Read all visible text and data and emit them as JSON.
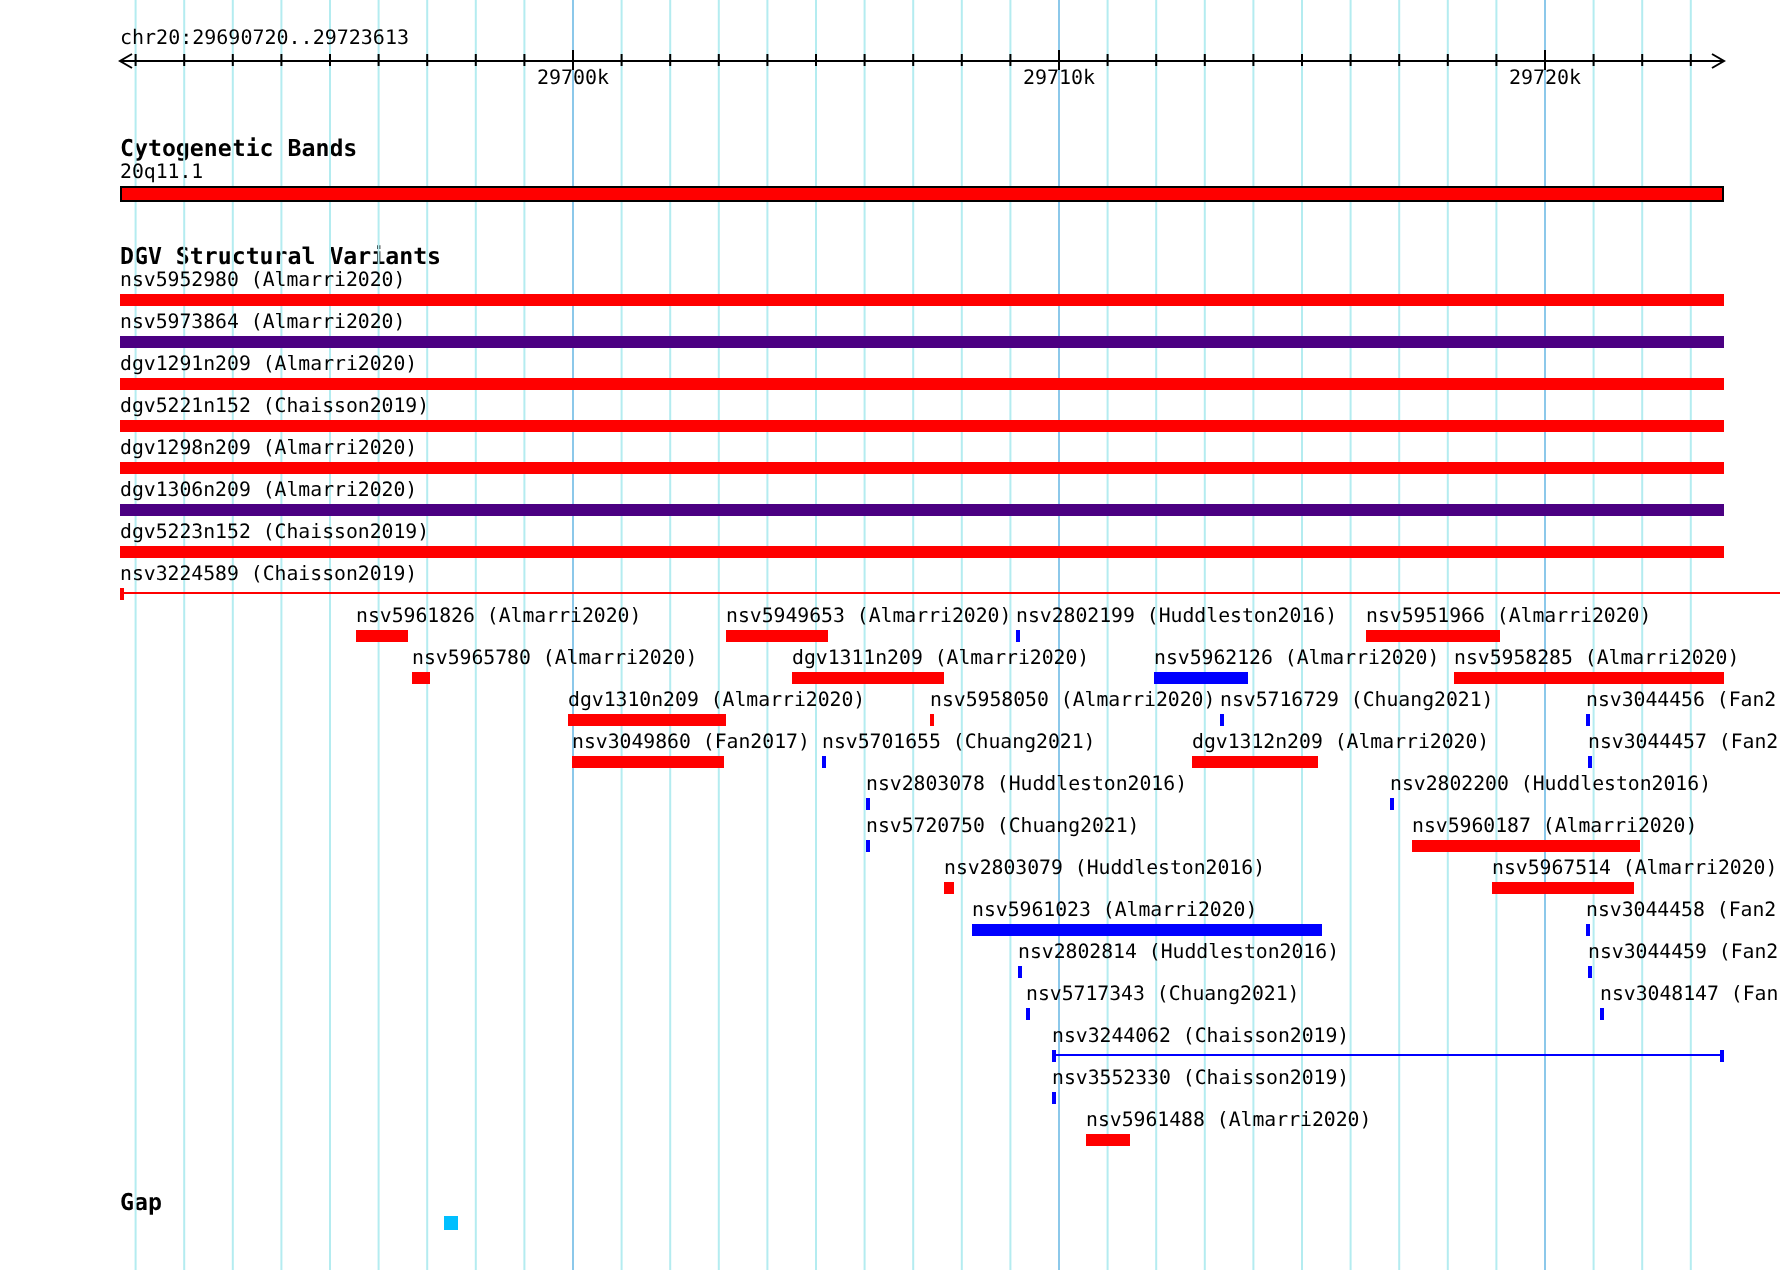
{
  "ruler": {
    "location": "chr20:29690720..29723613",
    "ticks": [
      "29700k",
      "29710k",
      "29720k"
    ]
  },
  "tracks": [
    {
      "kind": "cytoband",
      "title": "Cytogenetic Bands",
      "features": [
        {
          "label": "20q11.1",
          "color": "#ff0000"
        }
      ]
    },
    {
      "kind": "variants",
      "title": "DGV Structural Variants",
      "features": [
        {
          "label": "nsv5952980 (Almarri2020)",
          "color": "#ff0000",
          "kind": "bar"
        },
        {
          "label": "nsv5973864 (Almarri2020)",
          "color": "#4b0082",
          "kind": "bar"
        },
        {
          "label": "dgv1291n209 (Almarri2020)",
          "color": "#ff0000",
          "kind": "bar"
        },
        {
          "label": "dgv5221n152 (Chaisson2019)",
          "color": "#ff0000",
          "kind": "bar"
        },
        {
          "label": "dgv1298n209 (Almarri2020)",
          "color": "#ff0000",
          "kind": "bar"
        },
        {
          "label": "dgv1306n209 (Almarri2020)",
          "color": "#4b0082",
          "kind": "bar"
        },
        {
          "label": "dgv5223n152 (Chaisson2019)",
          "color": "#ff0000",
          "kind": "bar"
        },
        {
          "label": "nsv3224589 (Chaisson2019)",
          "color": "#ff0000",
          "kind": "line"
        },
        {
          "label": "nsv5961826 (Almarri2020)",
          "color": "#ff0000",
          "kind": "bar"
        },
        {
          "label": "nsv5949653 (Almarri2020)",
          "color": "#ff0000",
          "kind": "bar"
        },
        {
          "label": "nsv2802199 (Huddleston2016)",
          "color": "#0000ff",
          "kind": "bar"
        },
        {
          "label": "nsv5951966 (Almarri2020)",
          "color": "#ff0000",
          "kind": "bar"
        },
        {
          "label": "nsv5965780 (Almarri2020)",
          "color": "#ff0000",
          "kind": "bar"
        },
        {
          "label": "dgv1311n209 (Almarri2020)",
          "color": "#ff0000",
          "kind": "bar"
        },
        {
          "label": "nsv5962126 (Almarri2020)",
          "color": "#0000ff",
          "kind": "bar"
        },
        {
          "label": "nsv5958285 (Almarri2020)",
          "color": "#ff0000",
          "kind": "bar"
        },
        {
          "label": "dgv1310n209 (Almarri2020)",
          "color": "#ff0000",
          "kind": "bar"
        },
        {
          "label": "nsv5958050 (Almarri2020)",
          "color": "#ff0000",
          "kind": "bar"
        },
        {
          "label": "nsv5716729 (Chuang2021)",
          "color": "#0000ff",
          "kind": "bar"
        },
        {
          "label": "nsv3044456 (Fan2",
          "color": "#0000ff",
          "kind": "bar"
        },
        {
          "label": "nsv3049860 (Fan2017)",
          "color": "#ff0000",
          "kind": "bar"
        },
        {
          "label": "nsv5701655 (Chuang2021)",
          "color": "#0000ff",
          "kind": "bar"
        },
        {
          "label": "dgv1312n209 (Almarri2020)",
          "color": "#ff0000",
          "kind": "bar"
        },
        {
          "label": "nsv3044457 (Fan2",
          "color": "#0000ff",
          "kind": "bar"
        },
        {
          "label": "nsv2803078 (Huddleston2016)",
          "color": "#0000ff",
          "kind": "bar"
        },
        {
          "label": "nsv2802200 (Huddleston2016)",
          "color": "#0000ff",
          "kind": "bar"
        },
        {
          "label": "nsv5720750 (Chuang2021)",
          "color": "#0000ff",
          "kind": "bar"
        },
        {
          "label": "nsv5960187 (Almarri2020)",
          "color": "#ff0000",
          "kind": "bar"
        },
        {
          "label": "nsv2803079 (Huddleston2016)",
          "color": "#ff0000",
          "kind": "bar"
        },
        {
          "label": "nsv5967514 (Almarri2020)",
          "color": "#ff0000",
          "kind": "bar"
        },
        {
          "label": "nsv5961023 (Almarri2020)",
          "color": "#0000ff",
          "kind": "bar"
        },
        {
          "label": "nsv3044458 (Fan2",
          "color": "#0000ff",
          "kind": "bar"
        },
        {
          "label": "nsv2802814 (Huddleston2016)",
          "color": "#0000ff",
          "kind": "bar"
        },
        {
          "label": "nsv3044459 (Fan2",
          "color": "#0000ff",
          "kind": "bar"
        },
        {
          "label": "nsv5717343 (Chuang2021)",
          "color": "#0000ff",
          "kind": "bar"
        },
        {
          "label": "nsv3048147 (Fan",
          "color": "#0000ff",
          "kind": "bar"
        },
        {
          "label": "nsv3244062 (Chaisson2019)",
          "color": "#0000ff",
          "kind": "line"
        },
        {
          "label": "nsv3552330 (Chaisson2019)",
          "color": "#0000ff",
          "kind": "bar"
        },
        {
          "label": "nsv5961488 (Almarri2020)",
          "color": "#ff0000",
          "kind": "bar"
        }
      ]
    },
    {
      "kind": "gap",
      "title": "Gap",
      "features": [
        {
          "color": "#00bfff"
        }
      ]
    }
  ]
}
